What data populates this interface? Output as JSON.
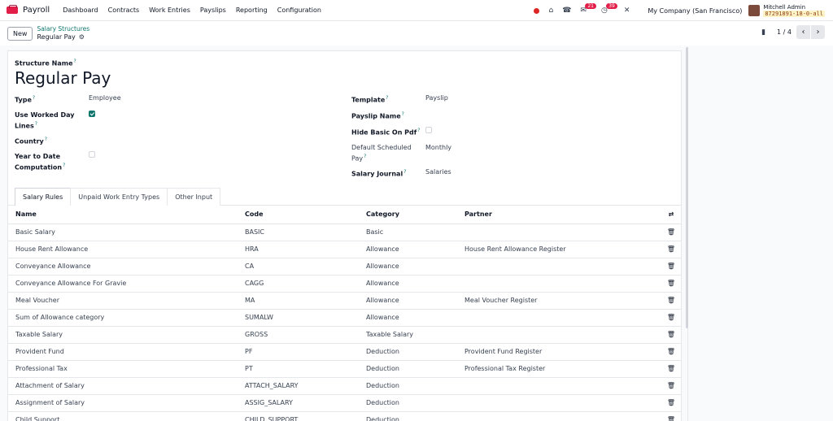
{
  "navbar": {
    "brand": "Payroll",
    "menu": [
      "Dashboard",
      "Contracts",
      "Work Entries",
      "Payslips",
      "Reporting",
      "Configuration"
    ],
    "messages_badge": "21",
    "activity_badge": "39",
    "company": "My Company (San Francisco)",
    "user_name": "Mitchell Admin",
    "db_name": "87291891-18-0-all"
  },
  "control": {
    "new_label": "New",
    "breadcrumb_parent": "Salary Structures",
    "breadcrumb_current": "Regular Pay",
    "pager": "1 / 4"
  },
  "form": {
    "structure_name_label": "Structure Name",
    "title": "Regular Pay",
    "type_label": "Type",
    "type_value": "Employee",
    "worked_day_label_1": "Use Worked Day",
    "worked_day_label_2": "Lines",
    "country_label": "Country",
    "ytd_label_1": "Year to Date",
    "ytd_label_2": "Computation",
    "template_label": "Template",
    "template_value": "Payslip",
    "payslip_name_label": "Payslip Name",
    "hide_basic_label": "Hide Basic On Pdf",
    "default_pay_label_1": "Default Scheduled",
    "default_pay_label_2": "Pay",
    "default_pay_value": "Monthly",
    "journal_label": "Salary Journal",
    "journal_value": "Salaries",
    "tooltip_mark": "?"
  },
  "tabs": [
    "Salary Rules",
    "Unpaid Work Entry Types",
    "Other Input"
  ],
  "table": {
    "headers": [
      "Name",
      "Code",
      "Category",
      "Partner"
    ],
    "rows": [
      [
        "Basic Salary",
        "BASIC",
        "Basic",
        ""
      ],
      [
        "House Rent Allowance",
        "HRA",
        "Allowance",
        "House Rent Allowance Register"
      ],
      [
        "Conveyance Allowance",
        "CA",
        "Allowance",
        ""
      ],
      [
        "Conveyance Allowance For Gravie",
        "CAGG",
        "Allowance",
        ""
      ],
      [
        "Meal Voucher",
        "MA",
        "Allowance",
        "Meal Voucher Register"
      ],
      [
        "Sum of Allowance category",
        "SUMALW",
        "Allowance",
        ""
      ],
      [
        "Taxable Salary",
        "GROSS",
        "Taxable Salary",
        ""
      ],
      [
        "Provident Fund",
        "PF",
        "Deduction",
        "Provident Fund Register"
      ],
      [
        "Professional Tax",
        "PT",
        "Deduction",
        "Professional Tax Register"
      ],
      [
        "Attachment of Salary",
        "ATTACH_SALARY",
        "Deduction",
        ""
      ],
      [
        "Assignment of Salary",
        "ASSIG_SALARY",
        "Deduction",
        ""
      ],
      [
        "Child Support",
        "CHILD_SUPPORT",
        "Deduction",
        ""
      ]
    ]
  }
}
